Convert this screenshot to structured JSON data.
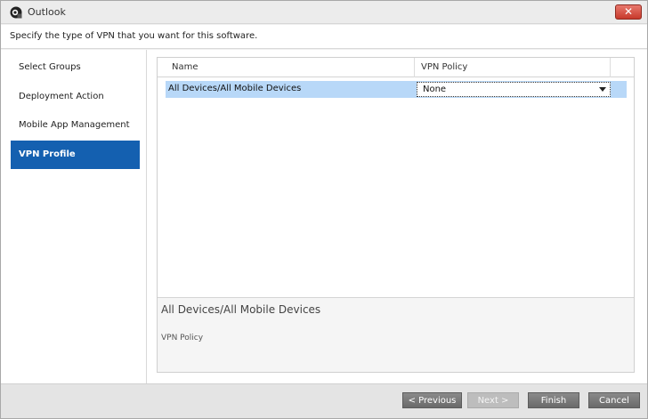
{
  "window": {
    "title": "Outlook",
    "close_label": "✕"
  },
  "instruction": "Specify the type of VPN that you want for this software.",
  "sidebar": {
    "items": [
      {
        "label": "Select Groups",
        "active": false
      },
      {
        "label": "Deployment Action",
        "active": false
      },
      {
        "label": "Mobile App Management",
        "active": false
      },
      {
        "label": "VPN Profile",
        "active": true
      }
    ]
  },
  "grid": {
    "columns": [
      "Name",
      "VPN Policy"
    ],
    "rows": [
      {
        "name": "All Devices/All Mobile Devices",
        "vpn_policy": "None"
      }
    ]
  },
  "details": {
    "title": "All Devices/All Mobile Devices",
    "label": "VPN Policy"
  },
  "footer": {
    "previous": "< Previous",
    "next": "Next >",
    "finish": "Finish",
    "cancel": "Cancel"
  },
  "colors": {
    "active_nav": "#1460b0",
    "selected_row": "#b8d8f8",
    "close_button": "#c7392b"
  }
}
